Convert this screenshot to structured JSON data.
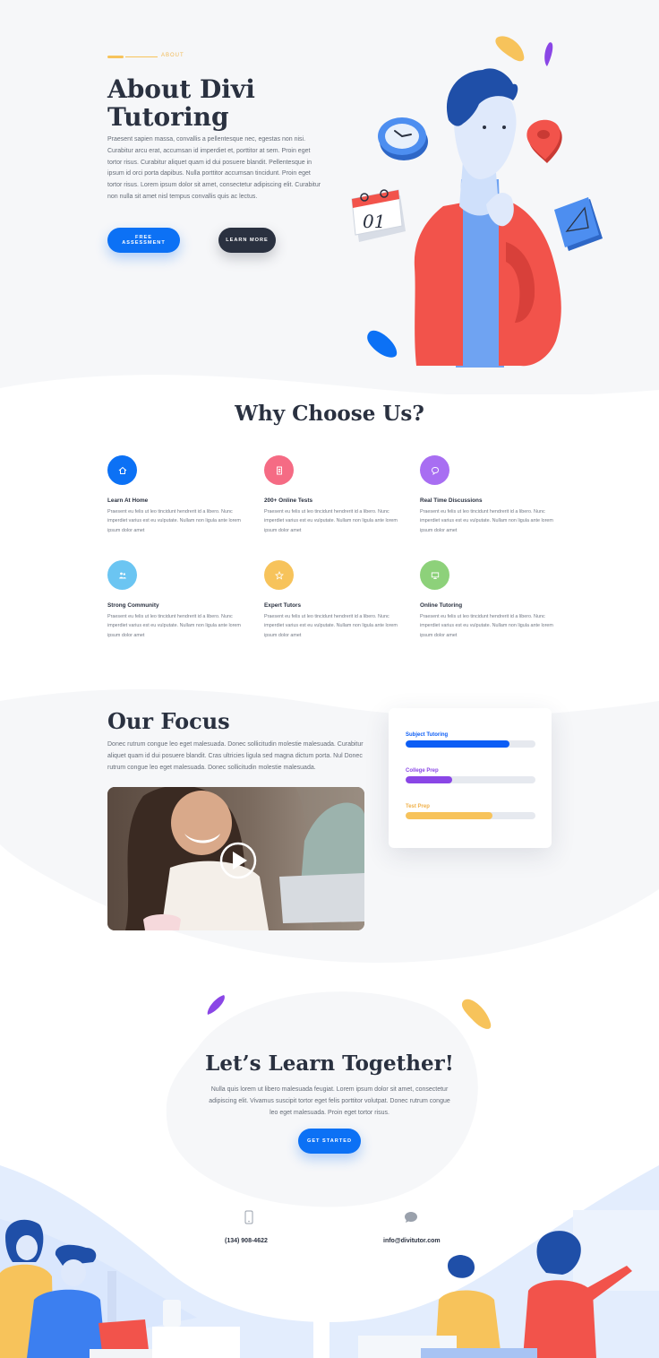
{
  "hero": {
    "eyebrow": "ABOUT",
    "title_line1": "About Divi",
    "title_line2": "Tutoring",
    "paragraph": "Praesent sapien massa, convallis a pellentesque nec, egestas non nisi. Curabitur arcu erat, accumsan id imperdiet et, porttitor at sem. Proin eget tortor risus. Curabitur aliquet quam id dui posuere blandit. Pellentesque in ipsum id orci porta dapibus. Nulla porttitor accumsan tincidunt. Proin eget tortor risus. Lorem ipsum dolor sit amet, consectetur adipiscing elit. Curabitur non nulla sit amet nisl tempus convallis quis ac lectus.",
    "btn_primary": "FREE ASSESSMENT",
    "btn_secondary": "LEARN MORE",
    "calendar_number": "01"
  },
  "why": {
    "title": "Why Choose Us?",
    "features": [
      {
        "title": "Learn At Home",
        "text": "Praesent eu felis ut leo tincidunt hendrerit id a libero. Nunc imperdiet varius est eu vulputate. Nullam non ligula ante lorem ipsum dolor amet",
        "icon": "home-icon",
        "color": "#0c71f5"
      },
      {
        "title": "200+ Online Tests",
        "text": "Praesent eu felis ut leo tincidunt hendrerit id a libero. Nunc imperdiet varius est eu vulputate. Nullam non ligula ante lorem ipsum dolor amet",
        "icon": "document-icon",
        "color": "#f56b84"
      },
      {
        "title": "Real Time Discussions",
        "text": "Praesent eu felis ut leo tincidunt hendrerit id a libero. Nunc imperdiet varius est eu vulputate. Nullam non ligula ante lorem ipsum dolor amet",
        "icon": "chat-icon",
        "color": "#a86ef2"
      },
      {
        "title": "Strong Community",
        "text": "Praesent eu felis ut leo tincidunt hendrerit id a libero. Nunc imperdiet varius est eu vulputate. Nullam non ligula ante lorem ipsum dolor amet",
        "icon": "people-icon",
        "color": "#6bc5f2"
      },
      {
        "title": "Expert Tutors",
        "text": "Praesent eu felis ut leo tincidunt hendrerit id a libero. Nunc imperdiet varius est eu vulputate. Nullam non ligula ante lorem ipsum dolor amet",
        "icon": "star-icon",
        "color": "#f7c35b"
      },
      {
        "title": "Online Tutoring",
        "text": "Praesent eu felis ut leo tincidunt hendrerit id a libero. Nunc imperdiet varius est eu vulputate. Nullam non ligula ante lorem ipsum dolor amet",
        "icon": "monitor-icon",
        "color": "#8dd17a"
      }
    ]
  },
  "focus": {
    "title": "Our Focus",
    "paragraph": "Donec rutrum congue leo eget malesuada. Donec sollicitudin molestie malesuada. Curabitur aliquet quam id dui posuere blandit. Cras ultricies ligula sed magna dictum porta. Nul Donec rutrum congue leo eget malesuada. Donec sollicitudin molestie malesuada.",
    "bars": [
      {
        "label": "Subject Tutoring",
        "value": 80,
        "color": "#0c5df5"
      },
      {
        "label": "College Prep",
        "value": 36,
        "color": "#8a46e6"
      },
      {
        "label": "Test Prep",
        "value": 67,
        "color": "#f7c35b"
      }
    ]
  },
  "cta": {
    "title": "Let’s Learn Together!",
    "paragraph": "Nulla quis lorem ut libero malesuada feugiat. Lorem ipsum dolor sit amet, consectetur adipiscing elit. Vivamus suscipit tortor eget felis porttitor volutpat. Donec rutrum congue leo eget malesuada. Proin eget tortor risus.",
    "button": "GET STARTED"
  },
  "contact": {
    "phone": "(134) 908-4622",
    "email": "info@divitutor.com"
  },
  "colors": {
    "accent_blue": "#0c71f5",
    "dark": "#2a3140",
    "yellow": "#f7c35b",
    "purple": "#8a46e6",
    "red": "#f2534b"
  }
}
